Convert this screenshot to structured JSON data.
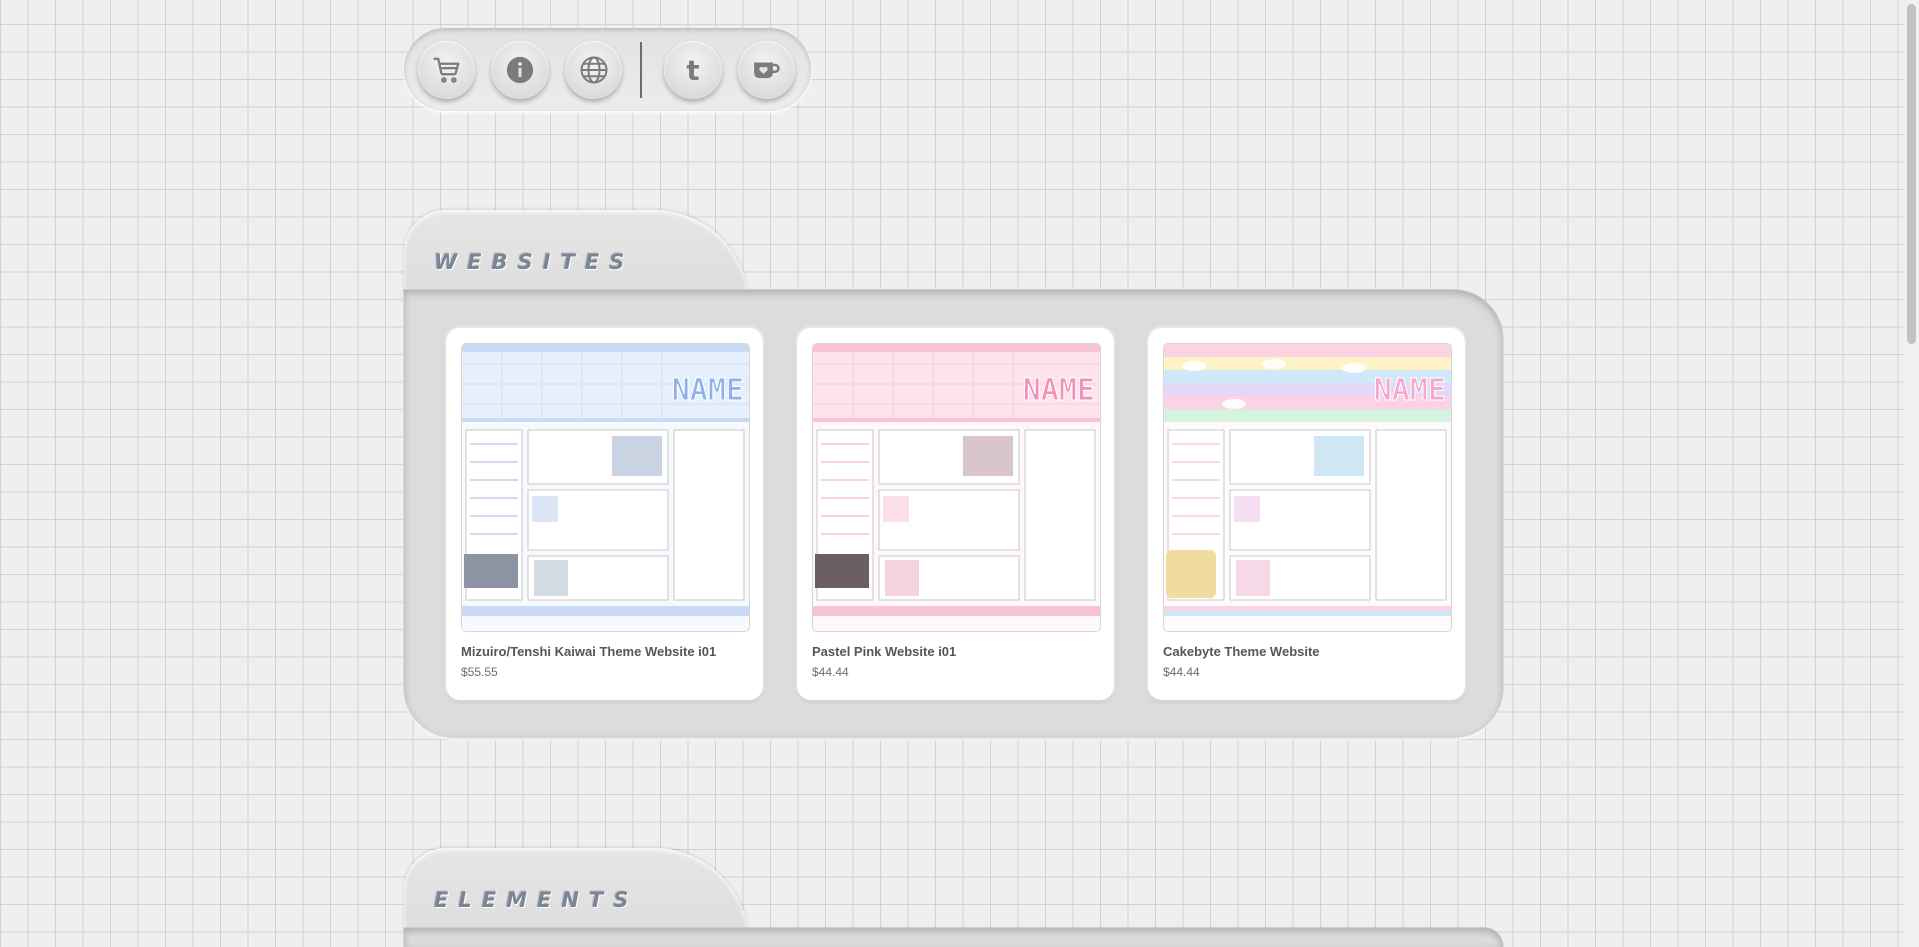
{
  "nav": {
    "icons": [
      "cart-icon",
      "info-icon",
      "globe-icon",
      "tumblr-icon",
      "kofi-icon"
    ],
    "tumblr_glyph": "t"
  },
  "sections": {
    "websites": {
      "title": "WEBSITES",
      "products": [
        {
          "title": "Mizuiro/Tenshi Kaiwai Theme Website i01",
          "price": "$55.55",
          "thumb_name": "NAME",
          "theme": "blue",
          "accent": "#8fb1ea",
          "bg": "#e6effc"
        },
        {
          "title": "Pastel Pink Website i01",
          "price": "$44.44",
          "thumb_name": "NAME",
          "theme": "pink",
          "accent": "#f291b8",
          "bg": "#fde3ec"
        },
        {
          "title": "Cakebyte Theme Website",
          "price": "$44.44",
          "thumb_name": "NAME",
          "theme": "rainbow",
          "accent": "#f7a6cc",
          "bg": "#fdeff5"
        }
      ]
    },
    "elements": {
      "title": "ELEMENTS"
    }
  },
  "colors": {
    "page_bg": "#efefef",
    "grid": "#d2d2d2",
    "panel": "#dcdcdc",
    "label": "#7c8594"
  }
}
